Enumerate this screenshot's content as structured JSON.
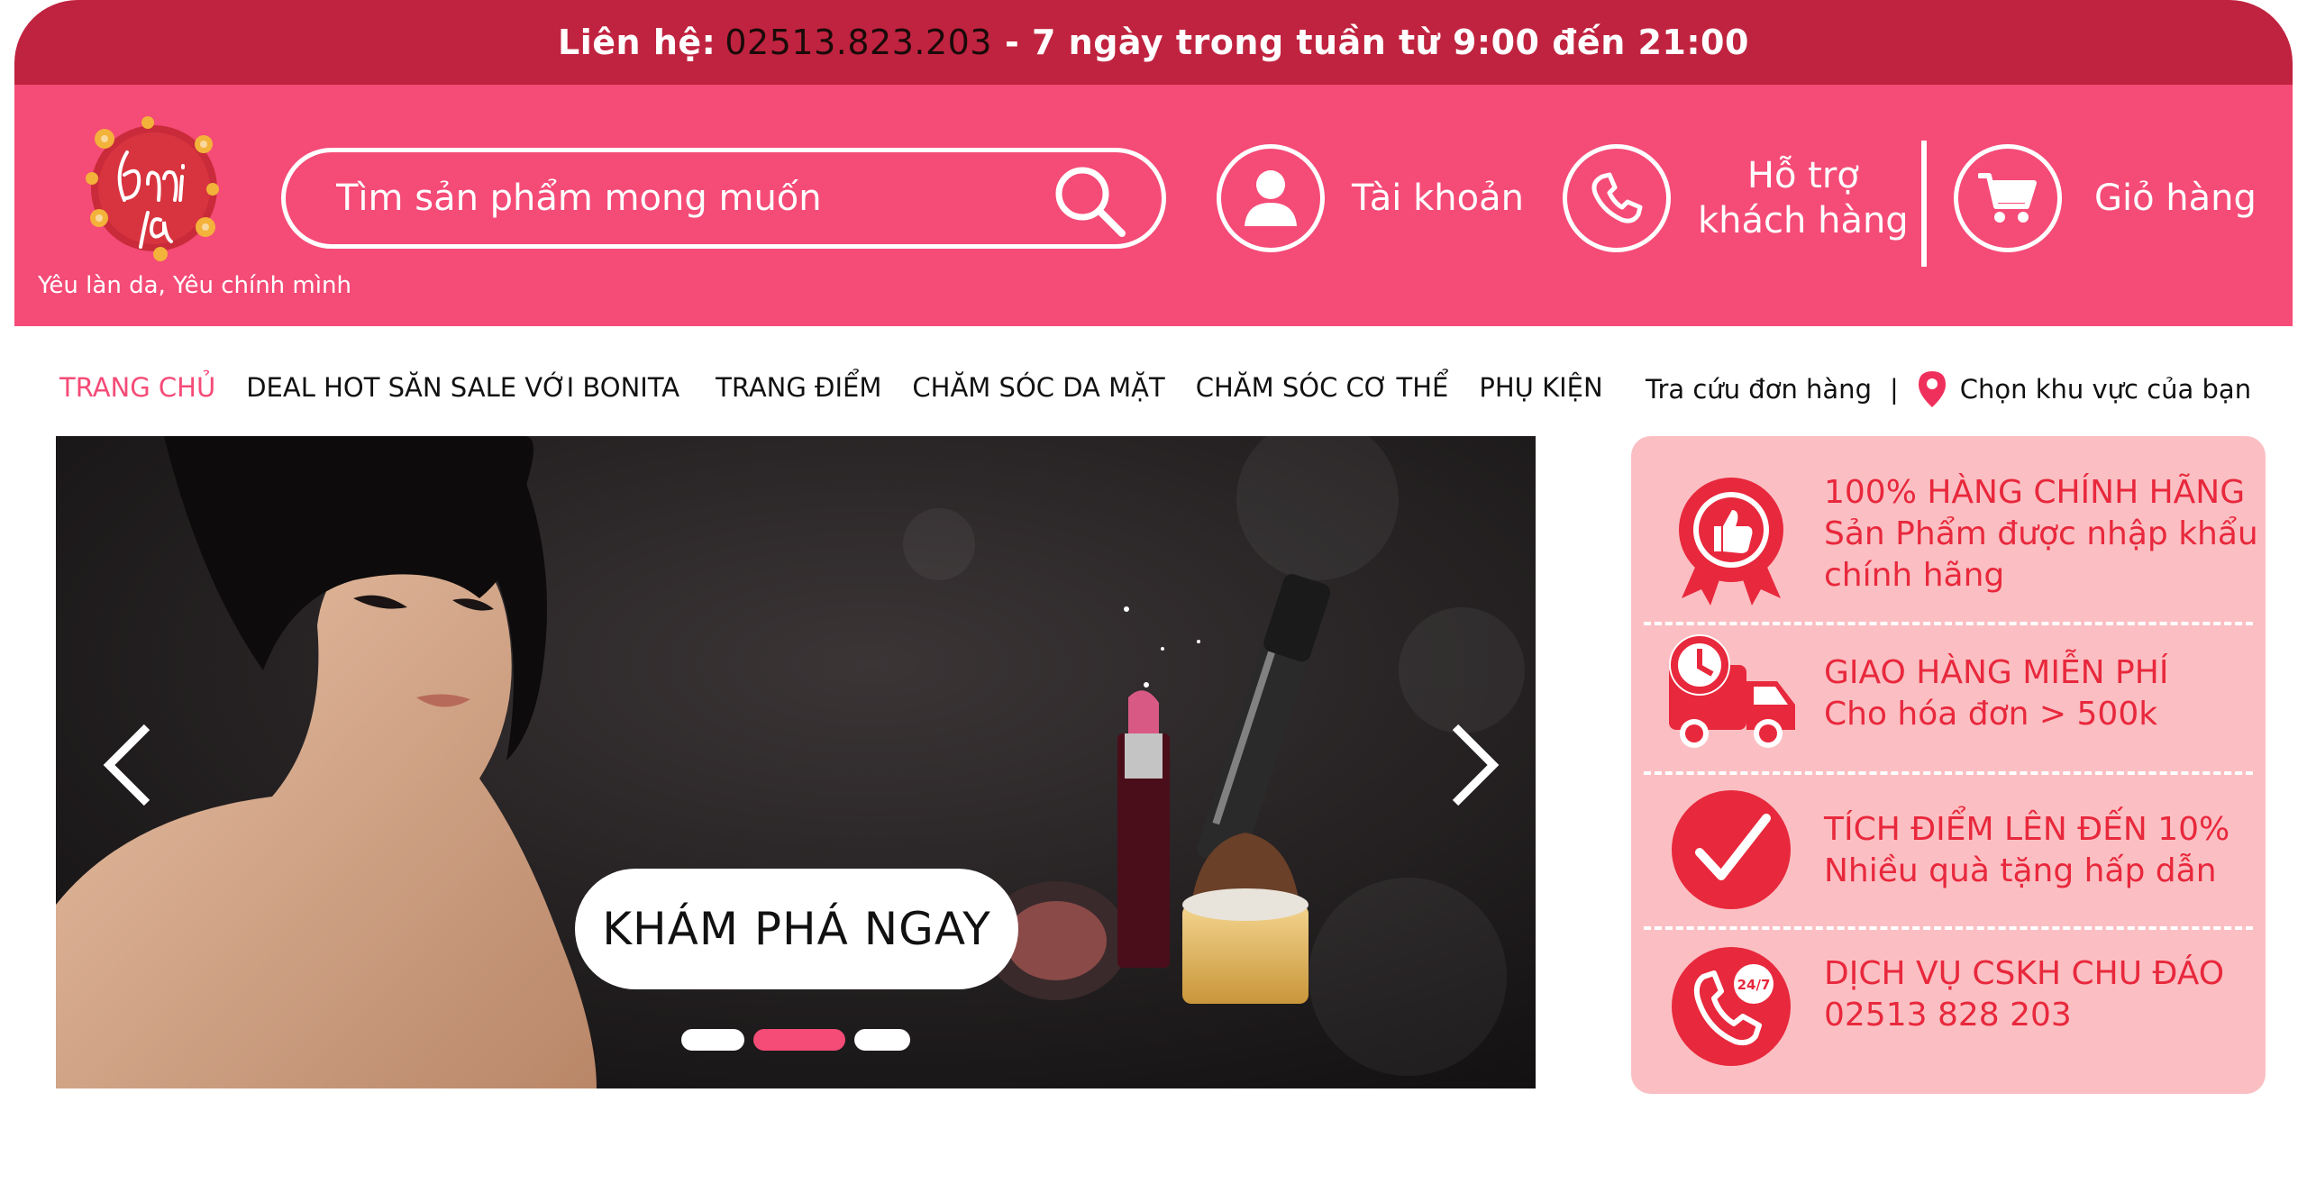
{
  "topbar": {
    "prefix": "Liên hệ:",
    "phone": "02513.823.203",
    "hours": "- 7 ngày trong tuần từ 9:00 đến 21:00"
  },
  "header": {
    "slogan": "Yêu làn da, Yêu chính mình",
    "search_placeholder": "Tìm sản phẩm mong muốn",
    "account_label": "Tài khoản",
    "support_line1": "Hỗ trợ",
    "support_line2": "khách hàng",
    "cart_label": "Giỏ hàng"
  },
  "nav": {
    "items": [
      "TRANG CHỦ",
      "DEAL HOT SĂN SALE VỚI BONITA",
      "TRANG ĐIỂM",
      "CHĂM SÓC DA MẶT",
      "CHĂM SÓC CƠ THỂ",
      "PHỤ KIỆN"
    ],
    "track_order": "Tra cứu đơn hàng",
    "separator": "|",
    "choose_region": "Chọn khu vực của bạn"
  },
  "banner": {
    "cta": "KHÁM PHÁ NGAY",
    "active_slide": 2,
    "slide_count": 3
  },
  "benefits": [
    {
      "title": "100% HÀNG CHÍNH HÃNG",
      "desc1": "Sản Phẩm được nhập khẩu",
      "desc2": "chính hãng"
    },
    {
      "title": "GIAO HÀNG MIỄN PHÍ",
      "desc1": "Cho hóa đơn > 500k",
      "desc2": ""
    },
    {
      "title": "TÍCH ĐIỂM LÊN ĐẾN 10%",
      "desc1": "Nhiều quà tặng hấp dẫn",
      "desc2": ""
    },
    {
      "title": "DỊCH VỤ CSKH CHU ĐÁO",
      "desc1": "02513 828 203",
      "desc2": ""
    }
  ],
  "colors": {
    "topbar": "#c0233f",
    "header": "#f54b77",
    "benefit_bg": "#fbbfc3",
    "benefit_text": "#e8283c"
  }
}
